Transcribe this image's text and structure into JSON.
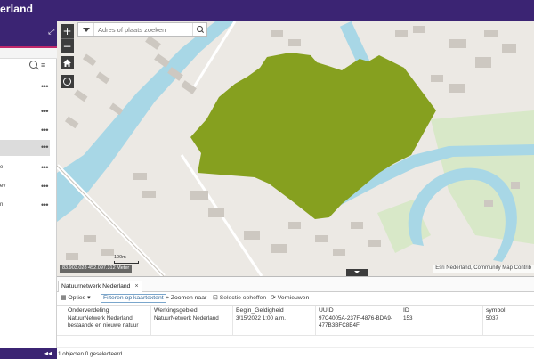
{
  "app": {
    "title": "erland"
  },
  "map": {
    "search_placeholder": "Adres of plaats zoeken",
    "zoom_in_label": "+",
    "zoom_out_label": "−",
    "coordinates": "83.903.028 452.097.312 Meter",
    "scale_label": "100m",
    "attribution": "Esri Nederland, Community Map Contrib",
    "colors": {
      "land": "#ece9e4",
      "water": "#a8d7e6",
      "buildings": "#cdc8c1",
      "highlight": "#86a01f",
      "green": "#d8e8c8"
    }
  },
  "table": {
    "tab_label": "Natuurnetwerk Nederland",
    "toolbar": {
      "options": "Opties",
      "filter": "Filteren op kaartextent",
      "zoom": "Zoomen naar",
      "clear_selection": "Selectie opheffen",
      "refresh": "Vernieuwen"
    },
    "columns": [
      "Onderverdeling",
      "Werkingsgebied",
      "Begin_Geldigheid",
      "UUID",
      "ID",
      "symbol"
    ],
    "rows": [
      {
        "onderverdeling": "NatuurNetwerk Nederland: bestaande en nieuwe natuur",
        "werkingsgebied": "NatuurNetwerk Nederland",
        "begin": "3/15/2022 1:00 a.m.",
        "uuid": "97C4005A-237F-4876-BDA9-477B3BFC8E4F",
        "id": "153",
        "symbol": "5037"
      }
    ],
    "status": "1 objecten 0 geselecteerd"
  },
  "sidebar": {
    "layers": [
      {
        "label": ""
      },
      {
        "label": ""
      },
      {
        "label": ""
      },
      {
        "label": ""
      },
      {
        "label": "e"
      },
      {
        "label": "ev"
      },
      {
        "label": "n"
      }
    ]
  }
}
